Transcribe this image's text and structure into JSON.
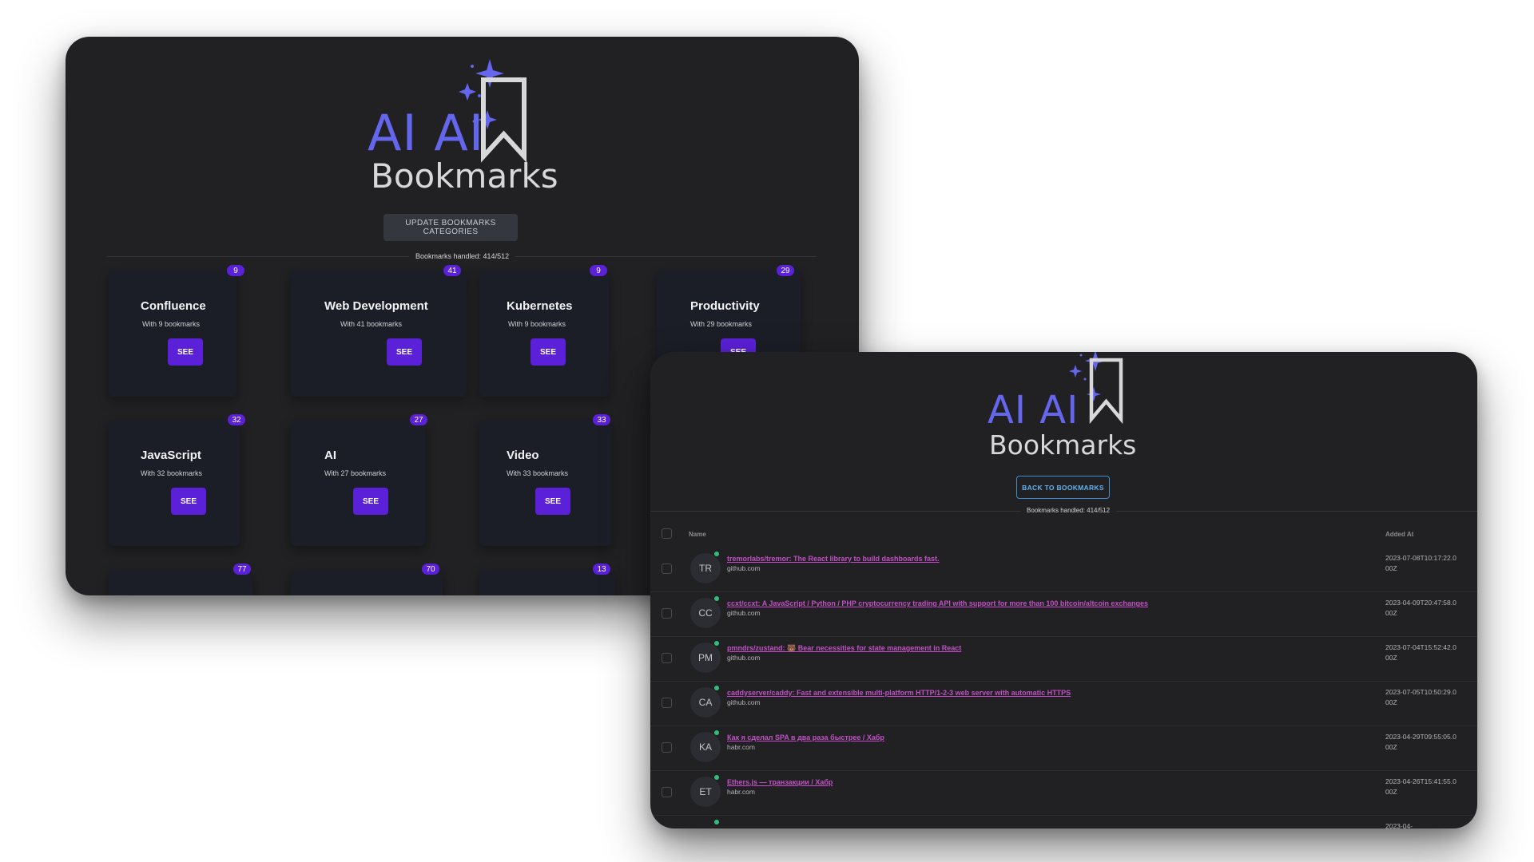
{
  "categories_screen": {
    "logo": {
      "ai_text": "AI AI",
      "bookmarks_text": "Bookmarks"
    },
    "update_button_label": "UPDATE BOOKMARKS CATEGORIES",
    "handled_text": "Bookmarks handled: 414/512",
    "see_label": "SEE",
    "categories": [
      {
        "name": "Confluence",
        "subtitle": "With 9 bookmarks",
        "count": "9"
      },
      {
        "name": "Web Development",
        "subtitle": "With 41 bookmarks",
        "count": "41"
      },
      {
        "name": "Kubernetes",
        "subtitle": "With 9 bookmarks",
        "count": "9"
      },
      {
        "name": "Productivity",
        "subtitle": "With 29 bookmarks",
        "count": "29"
      },
      {
        "name": "JavaScript",
        "subtitle": "With 32 bookmarks",
        "count": "32"
      },
      {
        "name": "AI",
        "subtitle": "With 27 bookmarks",
        "count": "27"
      },
      {
        "name": "Video",
        "subtitle": "With 33 bookmarks",
        "count": "33"
      },
      {
        "name": "",
        "subtitle": "",
        "count": "77"
      },
      {
        "name": "",
        "subtitle": "",
        "count": "70"
      },
      {
        "name": "",
        "subtitle": "",
        "count": "13"
      }
    ]
  },
  "bookmarks_screen": {
    "logo": {
      "ai_text": "AI AI",
      "bookmarks_text": "Bookmarks"
    },
    "back_button_label": "BACK TO BOOKMARKS",
    "handled_text": "Bookmarks handled: 414/512",
    "columns": {
      "name": "Name",
      "added_at": "Added At"
    },
    "rows": [
      {
        "initials": "TR",
        "title": "tremorlabs/tremor: The React library to build dashboards fast.",
        "domain": "github.com",
        "added_at": "2023-07-08T10:17:22.000Z"
      },
      {
        "initials": "CC",
        "title": "ccxt/ccxt: A JavaScript / Python / PHP cryptocurrency trading API with support for more than 100 bitcoin/altcoin exchanges",
        "domain": "github.com",
        "added_at": "2023-04-09T20:47:58.000Z"
      },
      {
        "initials": "PM",
        "title": "pmndrs/zustand: 🐻 Bear necessities for state management in React",
        "domain": "github.com",
        "added_at": "2023-07-04T15:52:42.000Z"
      },
      {
        "initials": "CA",
        "title": "caddyserver/caddy: Fast and extensible multi-platform HTTP/1-2-3 web server with automatic HTTPS",
        "domain": "github.com",
        "added_at": "2023-07-05T10:50:29.000Z"
      },
      {
        "initials": "KA",
        "title": "Как я сделал SPA в два раза быстрее / Хабр",
        "domain": "habr.com",
        "added_at": "2023-04-29T09:55:05.000Z"
      },
      {
        "initials": "ET",
        "title": "Ethers.js — транзакции / Хабр",
        "domain": "habr.com",
        "added_at": "2023-04-26T15:41:55.000Z"
      },
      {
        "initials": "",
        "title": "",
        "domain": "",
        "added_at": "2023-04-"
      }
    ]
  },
  "colors": {
    "accent": "#6466ee",
    "button_purple": "#5b21d8",
    "link_magenta": "#c34fc7",
    "status_green": "#2fc07e",
    "panel_bg": "#212123",
    "card_bg": "#1c1e27"
  }
}
